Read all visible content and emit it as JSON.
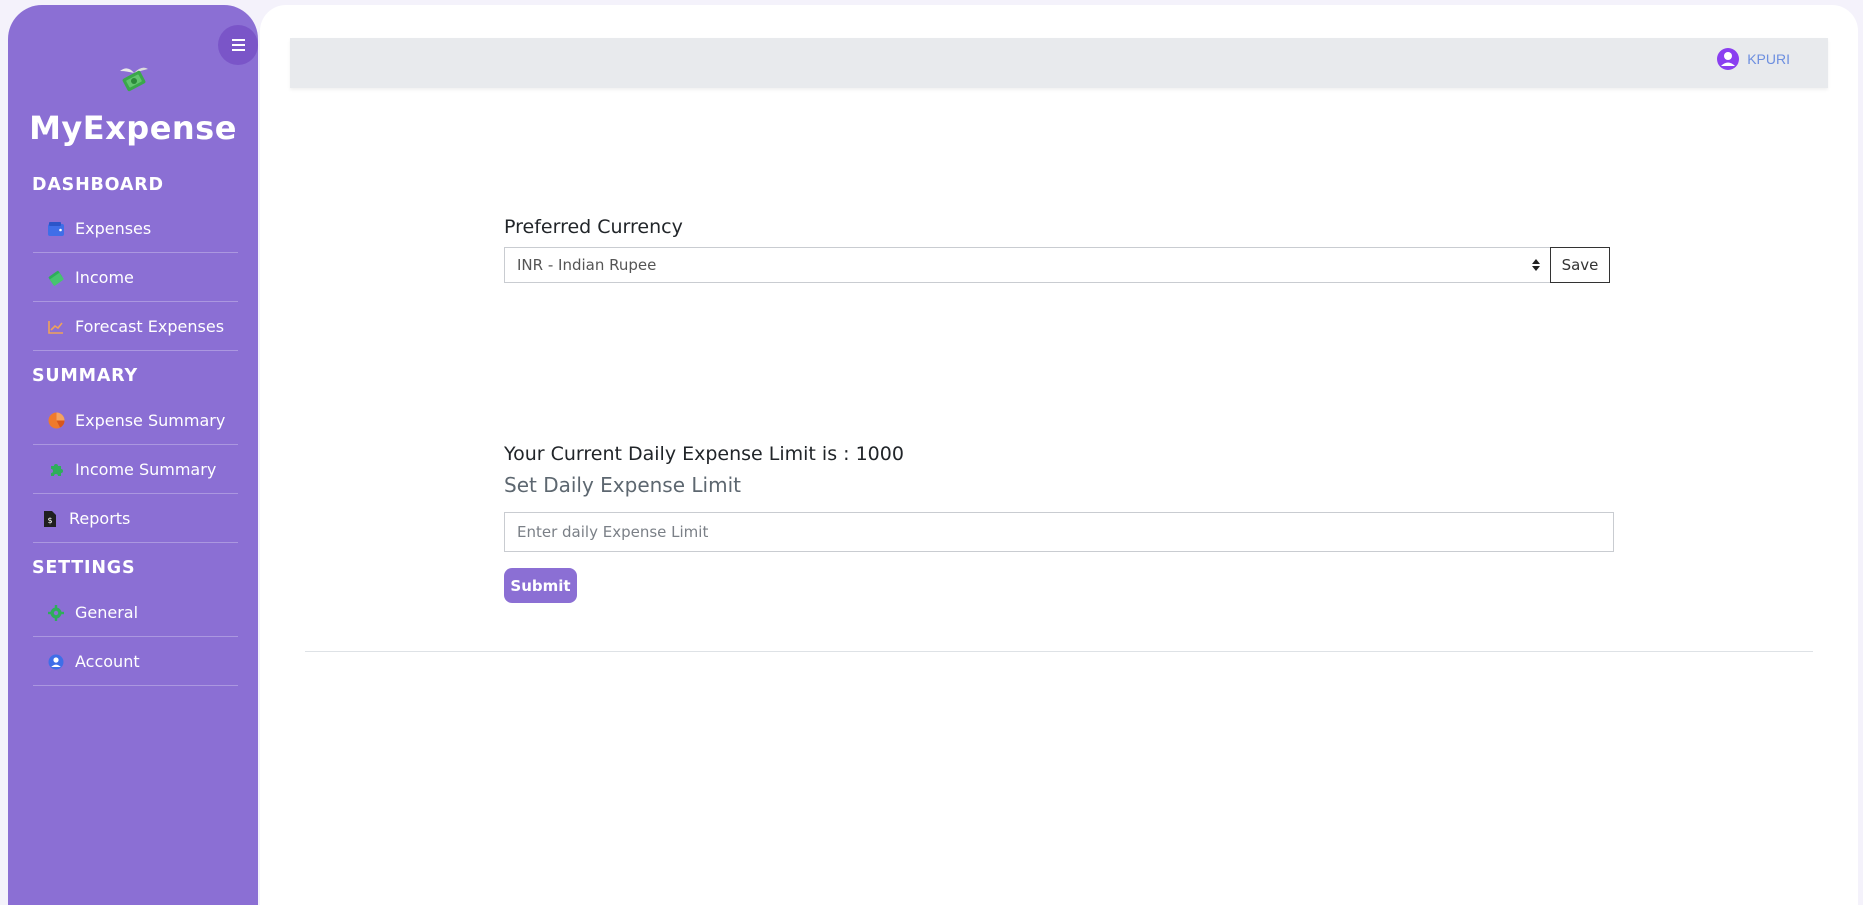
{
  "brand": {
    "title": "MyExpense",
    "icon": "money-with-wings-icon"
  },
  "sidebar": {
    "sections": [
      {
        "title": "DASHBOARD"
      },
      {
        "title": "SUMMARY"
      },
      {
        "title": "SETTINGS"
      }
    ],
    "items": [
      {
        "label": "Expenses",
        "icon": "wallet-icon",
        "color": "#3f6ee8"
      },
      {
        "label": "Income",
        "icon": "money-icon",
        "color": "#2eae5a"
      },
      {
        "label": "Forecast Expenses",
        "icon": "chart-line-icon",
        "color": "#f0a25a"
      },
      {
        "label": "Expense Summary",
        "icon": "pie-chart-icon",
        "color": "#f07a2c"
      },
      {
        "label": "Income Summary",
        "icon": "puzzle-icon",
        "color": "#2eae5a"
      },
      {
        "label": "Reports",
        "icon": "file-invoice-icon",
        "color": "#1f1f1f"
      },
      {
        "label": "General",
        "icon": "gear-icon",
        "color": "#2eae5a"
      },
      {
        "label": "Account",
        "icon": "user-circle-icon",
        "color": "#3f6ee8"
      }
    ]
  },
  "header": {
    "user_name": "KPURI",
    "user_icon": "user-circle-icon"
  },
  "currency": {
    "label": "Preferred Currency",
    "selected": "INR - Indian Rupee",
    "save_label": "Save"
  },
  "limit": {
    "current_text": "Your Current Daily Expense Limit is : ",
    "current_value": "1000",
    "set_label": "Set Daily Expense Limit",
    "placeholder": "Enter daily Expense Limit",
    "submit_label": "Submit"
  },
  "colors": {
    "sidebar": "#8b6fd4",
    "accent": "#8b6fd4",
    "user_link": "#6d8fe0"
  }
}
